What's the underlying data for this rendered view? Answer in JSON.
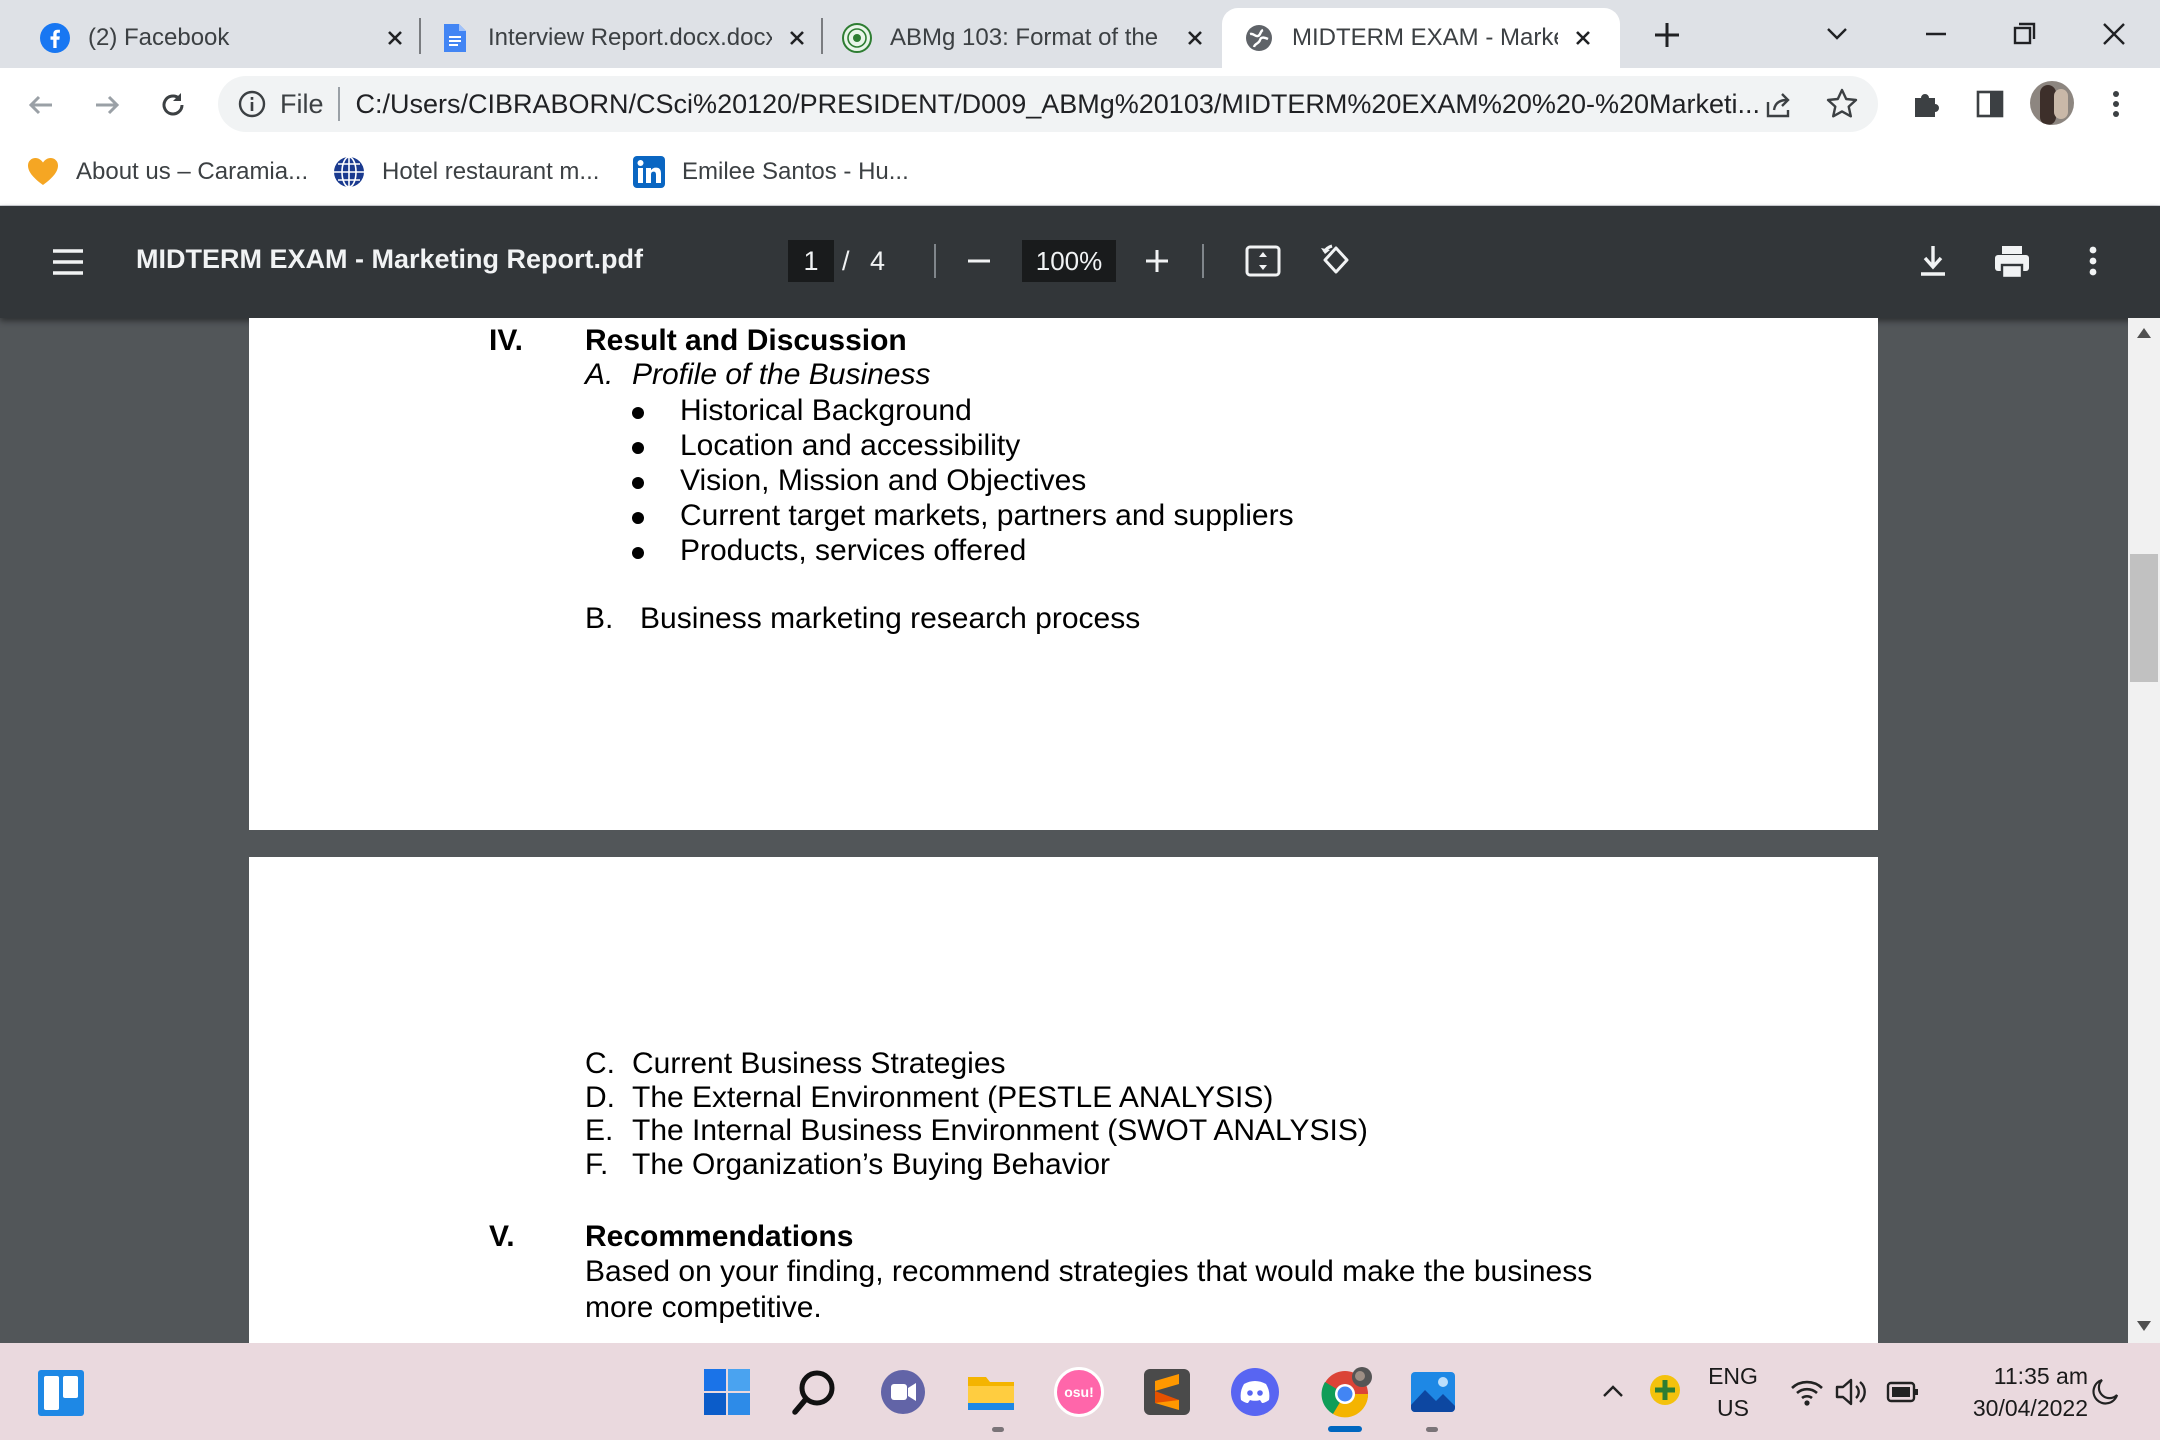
{
  "browser": {
    "tabs": [
      {
        "title": "(2) Facebook",
        "icon": "facebook-icon",
        "active": false
      },
      {
        "title": "Interview Report.docx.docx",
        "icon": "google-docs-icon",
        "active": false
      },
      {
        "title": "ABMg 103: Format of the",
        "icon": "course-seal-icon",
        "active": false
      },
      {
        "title": "MIDTERM EXAM - Marketing Report.pdf",
        "icon": "globe-icon",
        "active": true
      }
    ],
    "omnibox": {
      "scheme_label": "File",
      "url": "C:/Users/CIBRABORN/CSci%20120/PRESIDENT/D009_ABMg%20103/MIDTERM%20EXAM%20%20-%20Marketi..."
    },
    "bookmarks": [
      {
        "label": "About us – Caramia...",
        "icon": "heart-icon"
      },
      {
        "label": "Hotel restaurant m...",
        "icon": "globe-grid-icon"
      },
      {
        "label": "Emilee Santos - Hu...",
        "icon": "linkedin-icon"
      }
    ]
  },
  "pdf_viewer": {
    "filename": "MIDTERM EXAM - Marketing Report.pdf",
    "current_page": "1",
    "page_separator": "/",
    "total_pages": "4",
    "zoom": "100%"
  },
  "document": {
    "section_iv": {
      "numeral": "IV.",
      "heading": "Result and Discussion",
      "sub_a": {
        "letter": "A.",
        "title": "Profile of the Business",
        "bullets": [
          "Historical Background",
          "Location and accessibility",
          "Vision, Mission and Objectives",
          "Current target markets, partners and suppliers",
          "Products, services offered"
        ]
      },
      "sub_b": {
        "letter": "B.",
        "title": "Business marketing research process"
      },
      "more_items": [
        {
          "letter": "C.",
          "title": "Current Business Strategies"
        },
        {
          "letter": "D.",
          "title": "The External Environment (PESTLE ANALYSIS)"
        },
        {
          "letter": "E.",
          "title": "The Internal Business Environment (SWOT ANALYSIS)"
        },
        {
          "letter": "F.",
          "title": "The Organization’s Buying Behavior"
        }
      ]
    },
    "section_v": {
      "numeral": "V.",
      "heading": "Recommendations",
      "body_lines": [
        "Based on your finding, recommend strategies that would make the business",
        "more competitive."
      ]
    }
  },
  "taskbar": {
    "apps": [
      "windows-start-icon",
      "search-icon",
      "teams-chat-icon",
      "file-explorer-icon",
      "osu-icon",
      "sublime-text-icon",
      "discord-icon",
      "chrome-icon",
      "photos-icon"
    ],
    "osu_label": "osu!",
    "language": "ENG",
    "region": "US",
    "time": "11:35 am",
    "date": "30/04/2022"
  },
  "colors": {
    "tab_strip": "#dee1e6",
    "pdf_toolbar": "#323639",
    "pdf_background": "#525659",
    "taskbar": "#ead9de",
    "chrome_active_indicator": "#0067c0"
  }
}
